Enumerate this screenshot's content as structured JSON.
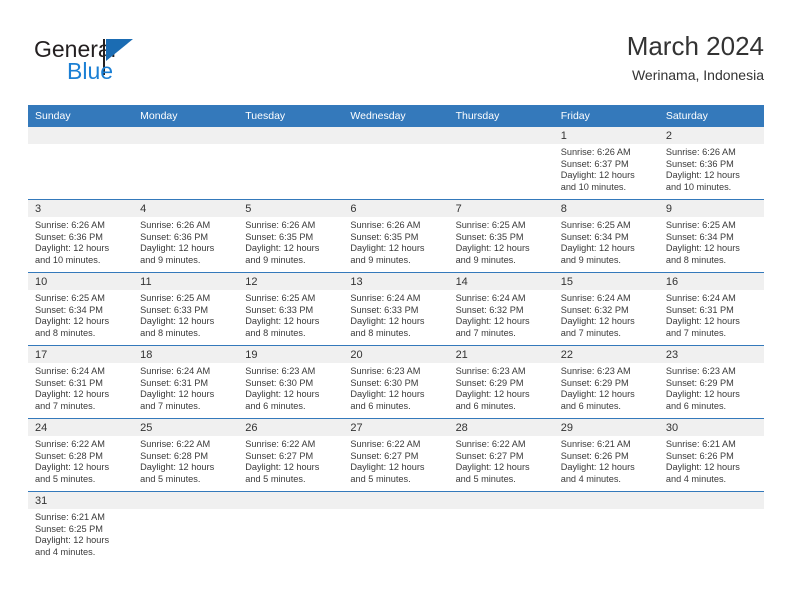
{
  "brand": {
    "name_part1": "General",
    "name_part2": "Blue",
    "flag_icon": "triangle-flag-icon"
  },
  "header": {
    "title": "March 2024",
    "subtitle": "Werinama, Indonesia"
  },
  "calendar": {
    "weekday_headers": [
      "Sunday",
      "Monday",
      "Tuesday",
      "Wednesday",
      "Thursday",
      "Friday",
      "Saturday"
    ],
    "accent_color": "#3479bb",
    "daynum_band_color": "#f0f0f0",
    "weeks": [
      [
        {
          "day": "",
          "sunrise": "",
          "sunset": "",
          "daylight1": "",
          "daylight2": "",
          "empty": true
        },
        {
          "day": "",
          "sunrise": "",
          "sunset": "",
          "daylight1": "",
          "daylight2": "",
          "empty": true
        },
        {
          "day": "",
          "sunrise": "",
          "sunset": "",
          "daylight1": "",
          "daylight2": "",
          "empty": true
        },
        {
          "day": "",
          "sunrise": "",
          "sunset": "",
          "daylight1": "",
          "daylight2": "",
          "empty": true
        },
        {
          "day": "",
          "sunrise": "",
          "sunset": "",
          "daylight1": "",
          "daylight2": "",
          "empty": true
        },
        {
          "day": "1",
          "sunrise": "Sunrise: 6:26 AM",
          "sunset": "Sunset: 6:37 PM",
          "daylight1": "Daylight: 12 hours",
          "daylight2": "and 10 minutes.",
          "empty": false
        },
        {
          "day": "2",
          "sunrise": "Sunrise: 6:26 AM",
          "sunset": "Sunset: 6:36 PM",
          "daylight1": "Daylight: 12 hours",
          "daylight2": "and 10 minutes.",
          "empty": false
        }
      ],
      [
        {
          "day": "3",
          "sunrise": "Sunrise: 6:26 AM",
          "sunset": "Sunset: 6:36 PM",
          "daylight1": "Daylight: 12 hours",
          "daylight2": "and 10 minutes.",
          "empty": false
        },
        {
          "day": "4",
          "sunrise": "Sunrise: 6:26 AM",
          "sunset": "Sunset: 6:36 PM",
          "daylight1": "Daylight: 12 hours",
          "daylight2": "and 9 minutes.",
          "empty": false
        },
        {
          "day": "5",
          "sunrise": "Sunrise: 6:26 AM",
          "sunset": "Sunset: 6:35 PM",
          "daylight1": "Daylight: 12 hours",
          "daylight2": "and 9 minutes.",
          "empty": false
        },
        {
          "day": "6",
          "sunrise": "Sunrise: 6:26 AM",
          "sunset": "Sunset: 6:35 PM",
          "daylight1": "Daylight: 12 hours",
          "daylight2": "and 9 minutes.",
          "empty": false
        },
        {
          "day": "7",
          "sunrise": "Sunrise: 6:25 AM",
          "sunset": "Sunset: 6:35 PM",
          "daylight1": "Daylight: 12 hours",
          "daylight2": "and 9 minutes.",
          "empty": false
        },
        {
          "day": "8",
          "sunrise": "Sunrise: 6:25 AM",
          "sunset": "Sunset: 6:34 PM",
          "daylight1": "Daylight: 12 hours",
          "daylight2": "and 9 minutes.",
          "empty": false
        },
        {
          "day": "9",
          "sunrise": "Sunrise: 6:25 AM",
          "sunset": "Sunset: 6:34 PM",
          "daylight1": "Daylight: 12 hours",
          "daylight2": "and 8 minutes.",
          "empty": false
        }
      ],
      [
        {
          "day": "10",
          "sunrise": "Sunrise: 6:25 AM",
          "sunset": "Sunset: 6:34 PM",
          "daylight1": "Daylight: 12 hours",
          "daylight2": "and 8 minutes.",
          "empty": false
        },
        {
          "day": "11",
          "sunrise": "Sunrise: 6:25 AM",
          "sunset": "Sunset: 6:33 PM",
          "daylight1": "Daylight: 12 hours",
          "daylight2": "and 8 minutes.",
          "empty": false
        },
        {
          "day": "12",
          "sunrise": "Sunrise: 6:25 AM",
          "sunset": "Sunset: 6:33 PM",
          "daylight1": "Daylight: 12 hours",
          "daylight2": "and 8 minutes.",
          "empty": false
        },
        {
          "day": "13",
          "sunrise": "Sunrise: 6:24 AM",
          "sunset": "Sunset: 6:33 PM",
          "daylight1": "Daylight: 12 hours",
          "daylight2": "and 8 minutes.",
          "empty": false
        },
        {
          "day": "14",
          "sunrise": "Sunrise: 6:24 AM",
          "sunset": "Sunset: 6:32 PM",
          "daylight1": "Daylight: 12 hours",
          "daylight2": "and 7 minutes.",
          "empty": false
        },
        {
          "day": "15",
          "sunrise": "Sunrise: 6:24 AM",
          "sunset": "Sunset: 6:32 PM",
          "daylight1": "Daylight: 12 hours",
          "daylight2": "and 7 minutes.",
          "empty": false
        },
        {
          "day": "16",
          "sunrise": "Sunrise: 6:24 AM",
          "sunset": "Sunset: 6:31 PM",
          "daylight1": "Daylight: 12 hours",
          "daylight2": "and 7 minutes.",
          "empty": false
        }
      ],
      [
        {
          "day": "17",
          "sunrise": "Sunrise: 6:24 AM",
          "sunset": "Sunset: 6:31 PM",
          "daylight1": "Daylight: 12 hours",
          "daylight2": "and 7 minutes.",
          "empty": false
        },
        {
          "day": "18",
          "sunrise": "Sunrise: 6:24 AM",
          "sunset": "Sunset: 6:31 PM",
          "daylight1": "Daylight: 12 hours",
          "daylight2": "and 7 minutes.",
          "empty": false
        },
        {
          "day": "19",
          "sunrise": "Sunrise: 6:23 AM",
          "sunset": "Sunset: 6:30 PM",
          "daylight1": "Daylight: 12 hours",
          "daylight2": "and 6 minutes.",
          "empty": false
        },
        {
          "day": "20",
          "sunrise": "Sunrise: 6:23 AM",
          "sunset": "Sunset: 6:30 PM",
          "daylight1": "Daylight: 12 hours",
          "daylight2": "and 6 minutes.",
          "empty": false
        },
        {
          "day": "21",
          "sunrise": "Sunrise: 6:23 AM",
          "sunset": "Sunset: 6:29 PM",
          "daylight1": "Daylight: 12 hours",
          "daylight2": "and 6 minutes.",
          "empty": false
        },
        {
          "day": "22",
          "sunrise": "Sunrise: 6:23 AM",
          "sunset": "Sunset: 6:29 PM",
          "daylight1": "Daylight: 12 hours",
          "daylight2": "and 6 minutes.",
          "empty": false
        },
        {
          "day": "23",
          "sunrise": "Sunrise: 6:23 AM",
          "sunset": "Sunset: 6:29 PM",
          "daylight1": "Daylight: 12 hours",
          "daylight2": "and 6 minutes.",
          "empty": false
        }
      ],
      [
        {
          "day": "24",
          "sunrise": "Sunrise: 6:22 AM",
          "sunset": "Sunset: 6:28 PM",
          "daylight1": "Daylight: 12 hours",
          "daylight2": "and 5 minutes.",
          "empty": false
        },
        {
          "day": "25",
          "sunrise": "Sunrise: 6:22 AM",
          "sunset": "Sunset: 6:28 PM",
          "daylight1": "Daylight: 12 hours",
          "daylight2": "and 5 minutes.",
          "empty": false
        },
        {
          "day": "26",
          "sunrise": "Sunrise: 6:22 AM",
          "sunset": "Sunset: 6:27 PM",
          "daylight1": "Daylight: 12 hours",
          "daylight2": "and 5 minutes.",
          "empty": false
        },
        {
          "day": "27",
          "sunrise": "Sunrise: 6:22 AM",
          "sunset": "Sunset: 6:27 PM",
          "daylight1": "Daylight: 12 hours",
          "daylight2": "and 5 minutes.",
          "empty": false
        },
        {
          "day": "28",
          "sunrise": "Sunrise: 6:22 AM",
          "sunset": "Sunset: 6:27 PM",
          "daylight1": "Daylight: 12 hours",
          "daylight2": "and 5 minutes.",
          "empty": false
        },
        {
          "day": "29",
          "sunrise": "Sunrise: 6:21 AM",
          "sunset": "Sunset: 6:26 PM",
          "daylight1": "Daylight: 12 hours",
          "daylight2": "and 4 minutes.",
          "empty": false
        },
        {
          "day": "30",
          "sunrise": "Sunrise: 6:21 AM",
          "sunset": "Sunset: 6:26 PM",
          "daylight1": "Daylight: 12 hours",
          "daylight2": "and 4 minutes.",
          "empty": false
        }
      ],
      [
        {
          "day": "31",
          "sunrise": "Sunrise: 6:21 AM",
          "sunset": "Sunset: 6:25 PM",
          "daylight1": "Daylight: 12 hours",
          "daylight2": "and 4 minutes.",
          "empty": false
        },
        {
          "day": "",
          "sunrise": "",
          "sunset": "",
          "daylight1": "",
          "daylight2": "",
          "empty": true
        },
        {
          "day": "",
          "sunrise": "",
          "sunset": "",
          "daylight1": "",
          "daylight2": "",
          "empty": true
        },
        {
          "day": "",
          "sunrise": "",
          "sunset": "",
          "daylight1": "",
          "daylight2": "",
          "empty": true
        },
        {
          "day": "",
          "sunrise": "",
          "sunset": "",
          "daylight1": "",
          "daylight2": "",
          "empty": true
        },
        {
          "day": "",
          "sunrise": "",
          "sunset": "",
          "daylight1": "",
          "daylight2": "",
          "empty": true
        },
        {
          "day": "",
          "sunrise": "",
          "sunset": "",
          "daylight1": "",
          "daylight2": "",
          "empty": true
        }
      ]
    ]
  }
}
